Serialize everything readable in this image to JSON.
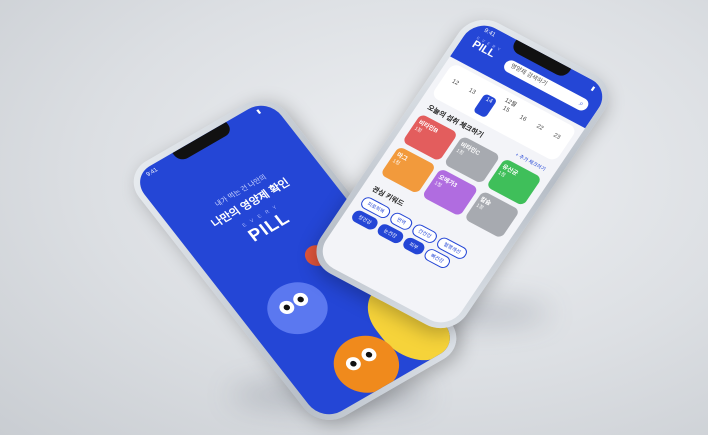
{
  "left_phone": {
    "status_time": "9:41",
    "tagline": "내가 먹는 건 나만의",
    "headline": "나만의 영양제 확인",
    "logo_sub": "E V E R Y",
    "logo": "PILL"
  },
  "right_phone": {
    "status_time": "9:41",
    "logo_sub": "E V E R Y",
    "logo": "PILL",
    "search_placeholder": "영양제 검색하기",
    "calendar": {
      "month": "12월",
      "days": [
        {
          "d": "12",
          "active": false
        },
        {
          "d": "13",
          "active": false
        },
        {
          "d": "14",
          "active": true
        },
        {
          "d": "15",
          "active": false
        },
        {
          "d": "16",
          "active": false
        },
        {
          "d": "22",
          "active": false
        },
        {
          "d": "23",
          "active": false
        }
      ]
    },
    "checklist_title": "오늘의 섭취 체크하기",
    "checklist_link": "+ 추가 체크하기",
    "cards": [
      {
        "name": "비타민B",
        "count": "1정",
        "color": "#e35d5d"
      },
      {
        "name": "비타민C",
        "count": "1정",
        "color": "#a7aab0"
      },
      {
        "name": "유산균",
        "count": "1정",
        "color": "#3fbf5a"
      },
      {
        "name": "마그",
        "count": "1정",
        "color": "#f29a3c"
      },
      {
        "name": "오메가3",
        "count": "1정",
        "color": "#b06ce0"
      },
      {
        "name": "칼슘",
        "count": "1정",
        "color": "#a7aab0"
      }
    ],
    "keywords_title": "관심 키워드",
    "tags": [
      {
        "t": "피로회복",
        "filled": false
      },
      {
        "t": "면역",
        "filled": false
      },
      {
        "t": "간건강",
        "filled": false
      },
      {
        "t": "혈행개선",
        "filled": false
      },
      {
        "t": "장건강",
        "filled": true
      },
      {
        "t": "눈건강",
        "filled": true
      },
      {
        "t": "피부",
        "filled": true
      },
      {
        "t": "뼈건강",
        "filled": false
      }
    ]
  }
}
